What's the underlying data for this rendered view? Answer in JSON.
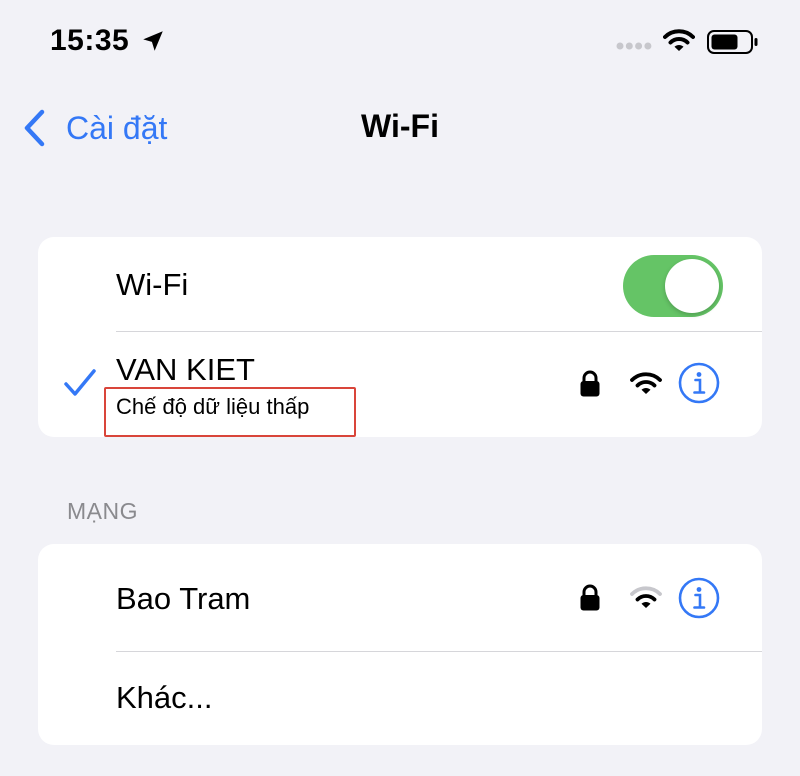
{
  "status_bar": {
    "time": "15:35"
  },
  "nav": {
    "back_label": "Cài đặt",
    "title": "Wi-Fi"
  },
  "wifi_toggle": {
    "label": "Wi-Fi",
    "enabled": true
  },
  "connected_network": {
    "name": "VAN KIET",
    "subtitle": "Chế độ dữ liệu thấp",
    "secured": true
  },
  "networks_section": {
    "header": "MẠNG",
    "items": [
      {
        "name": "Bao Tram",
        "secured": true
      }
    ],
    "other_label": "Khác..."
  },
  "colors": {
    "accent": "#3478f6",
    "toggle_on": "#65c466",
    "background": "#f2f2f7",
    "highlight": "#d9453a"
  },
  "icons": [
    "location-arrow-icon",
    "cellular-signal-icon",
    "wifi-icon",
    "battery-icon",
    "chevron-left-icon",
    "checkmark-icon",
    "lock-icon",
    "info-icon"
  ]
}
